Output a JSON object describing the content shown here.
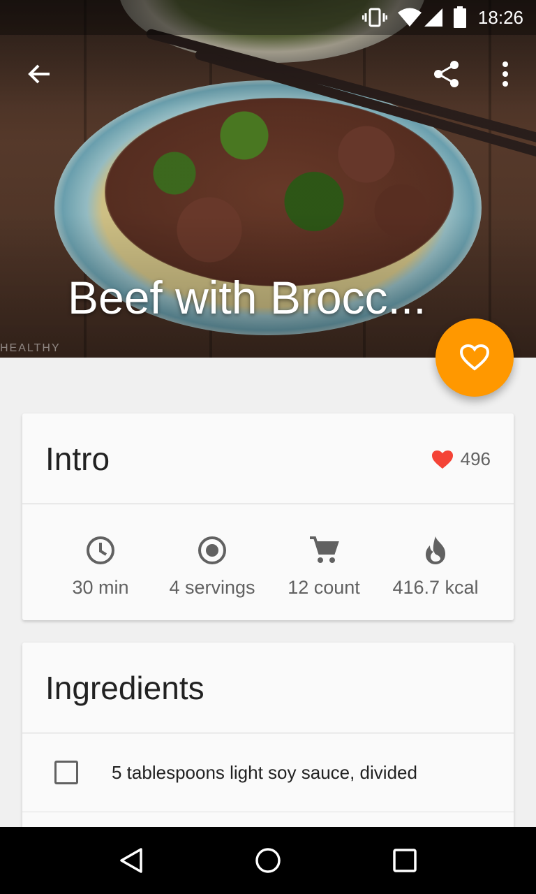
{
  "status_bar": {
    "time": "18:26",
    "icons": [
      "vibrate-icon",
      "wifi-icon",
      "signal-icon",
      "battery-icon"
    ]
  },
  "toolbar": {
    "back_icon": "arrow-back-icon",
    "share_icon": "share-icon",
    "menu_icon": "more-vert-icon"
  },
  "hero": {
    "title": "Beef with Brocc...",
    "watermark": "HEALTHY"
  },
  "fab": {
    "icon": "heart-outline-icon",
    "color": "#ff9800"
  },
  "intro": {
    "title": "Intro",
    "likes": "496",
    "likes_color": "#f44336",
    "stats": [
      {
        "icon": "clock-icon",
        "label": "30 min"
      },
      {
        "icon": "radio-target-icon",
        "label": "4 servings"
      },
      {
        "icon": "cart-icon",
        "label": "12 count"
      },
      {
        "icon": "flame-icon",
        "label": "416.7 kcal"
      }
    ]
  },
  "ingredients": {
    "title": "Ingredients",
    "items": [
      {
        "text": "5 tablespoons light soy sauce, divided",
        "checked": false
      }
    ]
  },
  "nav_bar": {
    "back": "nav-back-icon",
    "home": "nav-home-icon",
    "recents": "nav-recents-icon"
  }
}
